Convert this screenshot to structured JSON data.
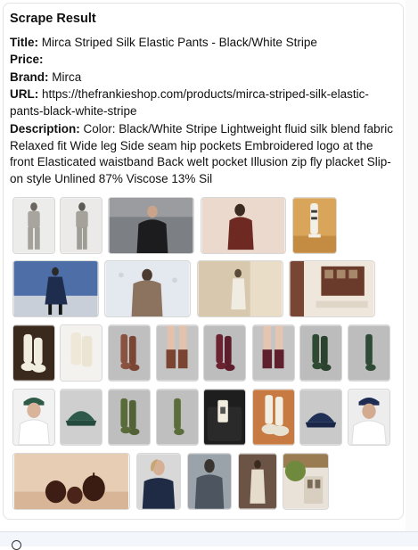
{
  "panel": {
    "heading": "Scrape Result",
    "fields": {
      "title": {
        "label": "Title:",
        "value": "Mirca Striped Silk Elastic Pants - Black/White Stripe"
      },
      "price": {
        "label": "Price:",
        "value": ""
      },
      "brand": {
        "label": "Brand:",
        "value": "Mirca"
      },
      "url": {
        "label": "URL:",
        "value": "https://thefrankieshop.com/products/mirca-striped-silk-elastic-pants-black-white-stripe"
      },
      "description": {
        "label": "Description:",
        "value": "Color: Black/White Stripe Lightweight fluid silk blend fabric Relaxed fit Wide leg Side seam hip pockets Embroidered logo at the front Elasticated waistband Back welt pocket Illusion zip fly placket Slip-on style Unlined 87% Viscose 13% Sil"
      }
    }
  },
  "images": [
    {
      "name": "model-grey-suit-front-image"
    },
    {
      "name": "model-grey-suit-side-image"
    },
    {
      "name": "model-black-jacket-image"
    },
    {
      "name": "model-burgundy-coat-image"
    },
    {
      "name": "sock-on-stand-image"
    },
    {
      "name": "model-walking-navy-coat-image"
    },
    {
      "name": "model-fur-coat-image"
    },
    {
      "name": "model-cream-outfit-room-image"
    },
    {
      "name": "store-interior-image"
    },
    {
      "name": "cream-socks-worn-image"
    },
    {
      "name": "cream-socks-folded-image"
    },
    {
      "name": "brown-socks-image"
    },
    {
      "name": "brown-socks-worn-image"
    },
    {
      "name": "burgundy-socks-image"
    },
    {
      "name": "burgundy-socks-worn-image"
    },
    {
      "name": "green-socks-image"
    },
    {
      "name": "green-socks-single-image"
    },
    {
      "name": "model-green-cap-image"
    },
    {
      "name": "green-cap-image"
    },
    {
      "name": "olive-socks-image"
    },
    {
      "name": "olive-socks-single-image"
    },
    {
      "name": "socks-in-box-image"
    },
    {
      "name": "cream-socks-worn-shoes-image"
    },
    {
      "name": "navy-cap-image"
    },
    {
      "name": "model-navy-cap-image"
    },
    {
      "name": "pear-candles-image"
    },
    {
      "name": "model-navy-coat-image"
    },
    {
      "name": "model-grey-coat-image"
    },
    {
      "name": "model-beige-trench-image"
    },
    {
      "name": "building-exterior-image"
    }
  ]
}
